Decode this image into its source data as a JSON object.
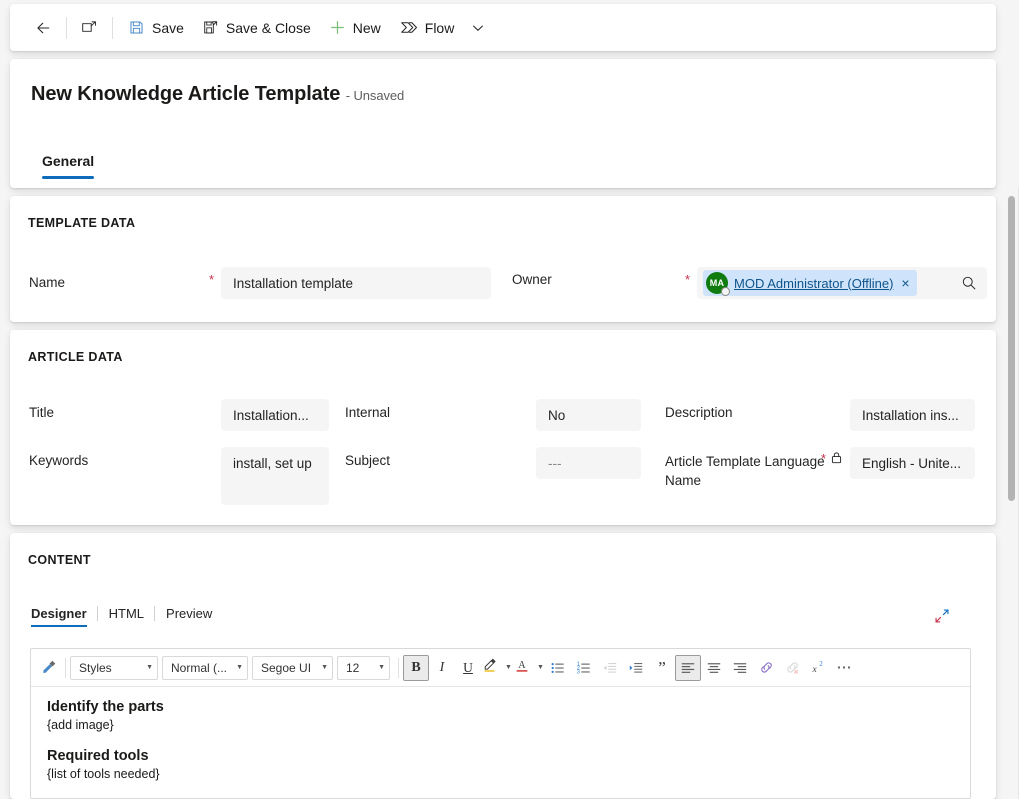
{
  "commandbar": {
    "back_label": "",
    "popout_label": "",
    "save_label": "Save",
    "save_close_label": "Save & Close",
    "new_label": "New",
    "flow_label": "Flow",
    "flow_caret_label": "",
    "icons": {
      "back": "arrow-left-icon",
      "popout": "pop-out-icon",
      "save": "save-floppy-icon",
      "save_close": "save-and-close-icon",
      "new": "plus-icon",
      "flow": "flow-icon",
      "chevron": "chevron-down-icon"
    }
  },
  "header": {
    "title": "New Knowledge Article Template",
    "subtitle": "- Unsaved",
    "tabs": [
      {
        "label": "General",
        "selected": true
      }
    ]
  },
  "template_data": {
    "section_title": "TEMPLATE DATA",
    "name": {
      "label": "Name",
      "required": "*",
      "value": "Installation template"
    },
    "owner": {
      "label": "Owner",
      "required": "*",
      "avatar_initials": "MA",
      "value": "MOD Administrator (Offline)",
      "remove_label": "×",
      "search_icon": "search-icon"
    }
  },
  "article_data": {
    "section_title": "ARTICLE DATA",
    "fields": [
      {
        "label": "Title",
        "value": "Installation...",
        "required": "",
        "locked": false
      },
      {
        "label": "Internal",
        "value": "No",
        "required": "",
        "locked": false
      },
      {
        "label": "Description",
        "value": "Installation ins...",
        "required": "",
        "locked": false
      },
      {
        "label": "Keywords",
        "value": "install, set up",
        "required": "",
        "locked": false
      },
      {
        "label": "Subject",
        "value": "---",
        "required": "",
        "locked": false,
        "placeholder": true
      },
      {
        "label": "Article Template Language Name",
        "value": "English - Unite...",
        "required": "*",
        "locked": true
      }
    ]
  },
  "content": {
    "section_title": "CONTENT",
    "tabs": [
      {
        "label": "Designer",
        "selected": true
      },
      {
        "label": "HTML",
        "selected": false
      },
      {
        "label": "Preview",
        "selected": false
      }
    ],
    "expand_icon": "expand-diagonal-icon",
    "toolbar": {
      "format_painter": "format-painter-icon",
      "styles": "Styles",
      "paragraph_format": "Normal (...",
      "font_family": "Segoe UI",
      "font_size": "12",
      "bold": "B",
      "italic": "I",
      "underline": "U",
      "highlight": "highlight-icon",
      "font_color": "A",
      "bulleted_list": "bulleted-list-icon",
      "numbered_list": "numbered-list-icon",
      "decrease_indent": "decrease-indent-icon",
      "increase_indent": "increase-indent-icon",
      "blockquote": "”",
      "align_left": "align-left-icon",
      "align_center": "align-center-icon",
      "align_right": "align-right-icon",
      "insert_link": "link-icon",
      "remove_link": "unlink-icon",
      "superscript": "superscript-icon",
      "more": "⋯"
    },
    "body": [
      {
        "type": "heading",
        "text": "Identify the parts"
      },
      {
        "type": "paragraph",
        "text": "{add image}"
      },
      {
        "type": "heading",
        "text": "Required tools"
      },
      {
        "type": "paragraph",
        "text": "{list of tools needed}"
      }
    ]
  },
  "colors": {
    "accent": "#0f6cbd",
    "required": "#c4314b",
    "link": "#0f548c",
    "avatar": "#107c10",
    "field_bg": "#f5f5f5",
    "new_icon": "#7bbf7b"
  }
}
